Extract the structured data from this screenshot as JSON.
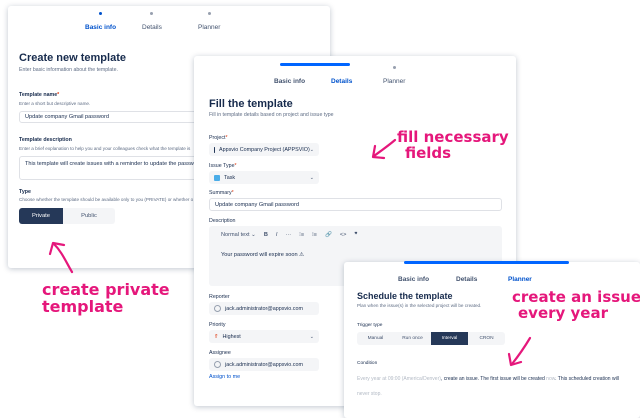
{
  "steps": {
    "basic": "Basic info",
    "details": "Details",
    "planner": "Planner"
  },
  "p1": {
    "title": "Create new template",
    "subtitle": "Enter basic information about the template.",
    "name_label": "Template name",
    "name_hint": "Enter a short but descriptive name.",
    "name_value": "Update company Gmail password",
    "desc_label": "Template description",
    "desc_hint": "Enter a brief explanation to help you and your colleagues check what the template is",
    "desc_value": "This template will create issues with a reminder to update the password.",
    "type_label": "Type",
    "type_hint": "Choose whether the template should be available only to you (PRIVATE) or whether o",
    "type_options": [
      "Private",
      "Public"
    ]
  },
  "p2": {
    "title": "Fill the template",
    "subtitle": "Fill in template details based on project and issue type",
    "project_label": "Project",
    "project_value": "Appsvio Company Project (APPSVIO)",
    "issuetype_label": "Issue Type",
    "issuetype_value": "Task",
    "summary_label": "Summary",
    "summary_value": "Update company Gmail password",
    "description_label": "Description",
    "toolbar": {
      "text_style": "Normal text",
      "bold": "B",
      "italic": "I",
      "more": "···",
      "bullets": "⁝≡",
      "numbers": "⁞≡",
      "link": "🔗",
      "code": "<>",
      "quote": "❞"
    },
    "description_text": "Your password will expire soon ⚠",
    "reporter_label": "Reporter",
    "reporter_value": "jack.administrator@appsvio.com",
    "priority_label": "Priority",
    "priority_value": "Highest",
    "assignee_label": "Assignee",
    "assignee_value": "jack.administrator@appsvio.com",
    "assign_me": "Assign to me"
  },
  "p3": {
    "title": "Schedule the template",
    "subtitle": "Plan when the issue(s) in the selected project will be created.",
    "trigger_label": "Trigger type",
    "trigger_options": [
      "Manual",
      "Run once",
      "Interval",
      "CRON"
    ],
    "condition_label": "Condition",
    "condition_pre": "Every year at 09:00 (America/Denver)",
    "condition_mid": ", create an issue. The first issue will be created",
    "condition_now": "now",
    "condition_post": ". This scheduled creation will",
    "condition_end": "never stop."
  },
  "annotations": {
    "private": [
      "create private",
      "template"
    ],
    "fill": [
      "fill necessary",
      "fields"
    ],
    "issue": [
      "create an issue",
      "every year"
    ]
  },
  "colors": {
    "accent": "#0052cc",
    "dark": "#253858",
    "annotation": "#e5177b"
  }
}
